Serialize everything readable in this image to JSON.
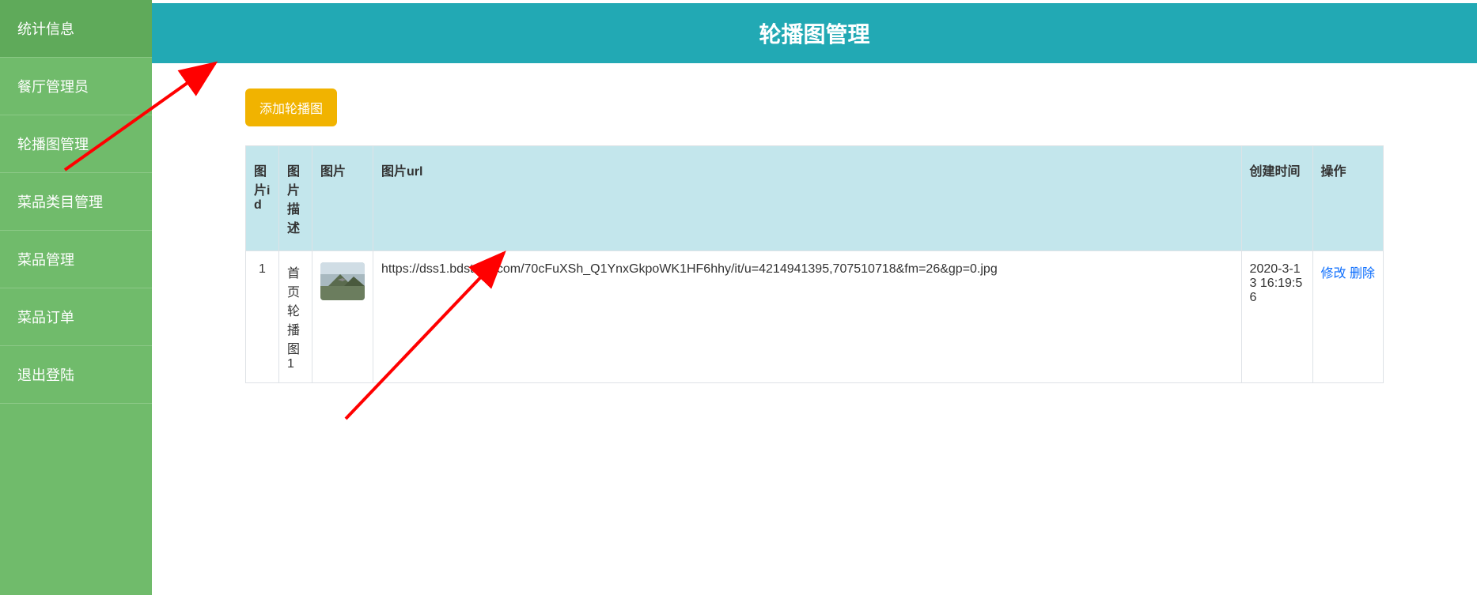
{
  "sidebar": {
    "items": [
      {
        "label": "统计信息"
      },
      {
        "label": "餐厅管理员"
      },
      {
        "label": "轮播图管理"
      },
      {
        "label": "菜品类目管理"
      },
      {
        "label": "菜品管理"
      },
      {
        "label": "菜品订单"
      },
      {
        "label": "退出登陆"
      }
    ]
  },
  "header": {
    "title": "轮播图管理"
  },
  "toolbar": {
    "add_label": "添加轮播图"
  },
  "table": {
    "headers": {
      "id": "图片id",
      "desc": "图片描述",
      "image": "图片",
      "url": "图片url",
      "time": "创建时间",
      "action": "操作"
    },
    "rows": [
      {
        "id": "1",
        "desc": "首页轮播图1",
        "url": "https://dss1.bdstatic.com/70cFuXSh_Q1YnxGkpoWK1HF6hhy/it/u=4214941395,707510718&fm=26&gp=0.jpg",
        "time": "2020-3-13 16:19:56",
        "edit_label": "修改",
        "delete_label": "删除"
      }
    ]
  }
}
